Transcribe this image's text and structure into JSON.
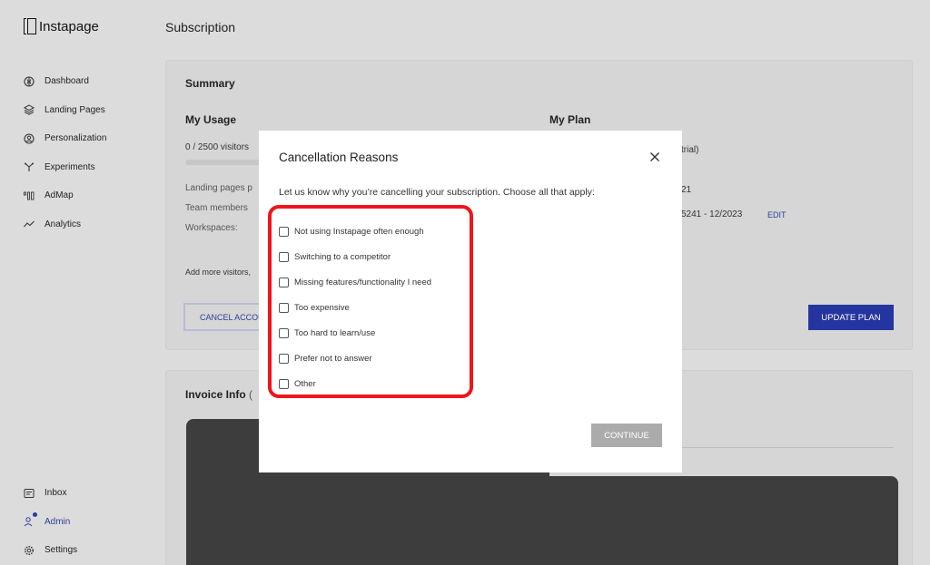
{
  "app": {
    "name": "Instapage"
  },
  "sidebar": {
    "items": [
      {
        "label": "Dashboard",
        "icon": "dashboard-icon"
      },
      {
        "label": "Landing Pages",
        "icon": "layers-icon"
      },
      {
        "label": "Personalization",
        "icon": "user-circle-icon"
      },
      {
        "label": "Experiments",
        "icon": "branch-icon"
      },
      {
        "label": "AdMap",
        "icon": "admap-icon"
      },
      {
        "label": "Analytics",
        "icon": "trend-icon"
      }
    ],
    "bottom_items": [
      {
        "label": "Inbox",
        "icon": "inbox-icon"
      },
      {
        "label": "Admin",
        "icon": "admin-icon"
      },
      {
        "label": "Settings",
        "icon": "gear-icon"
      }
    ],
    "active": "Admin"
  },
  "page": {
    "title": "Subscription"
  },
  "summary": {
    "title": "Summary",
    "usage_heading": "My Usage",
    "usage_text": "0 / 2500 visitors",
    "usage_fraction": 0.0,
    "labels": [
      "Landing pages p",
      "Team members",
      "Workspaces:"
    ],
    "add_more": "Add more visitors,",
    "cancel_button": "CANCEL ACCOUNT",
    "plan_heading": "My Plan",
    "plan_trial": "trial)",
    "plan_year": "21",
    "plan_card": "5241 - 12/2023",
    "edit": "EDIT",
    "update_button": "UPDATE PLAN"
  },
  "invoice": {
    "title": "Invoice Info",
    "paren": "("
  },
  "modal": {
    "title": "Cancellation Reasons",
    "prompt": "Let us know why you’re cancelling your subscription. Choose all that apply:",
    "options": [
      "Not using Instapage often enough",
      "Switching to a competitor",
      "Missing features/functionality I need",
      "Too expensive",
      "Too hard to learn/use",
      "Prefer not to answer",
      "Other"
    ],
    "continue_button": "CONTINUE"
  },
  "colors": {
    "accent": "#2535a0",
    "highlight": "#f0141c",
    "redaction": "#3d3d3d"
  }
}
